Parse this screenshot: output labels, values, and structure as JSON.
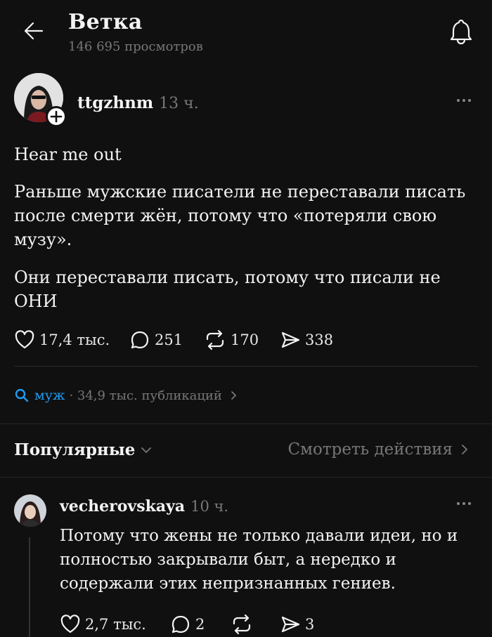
{
  "header": {
    "title": "Ветка",
    "subtitle": "146 695 просмотров"
  },
  "post": {
    "username": "ttgzhnm",
    "time": "13 ч.",
    "paragraphs": [
      "Hear me out",
      "Раньше мужские писатели не переставали писать после смерти жён, потому что «потеряли свою музу».",
      "Они переставали писать, потому что писали не ОНИ"
    ],
    "likes": "17,4 тыс.",
    "comments": "251",
    "reposts": "170",
    "shares": "338"
  },
  "tag": {
    "name": "муж",
    "info": "· 34,9 тыс. публикаций"
  },
  "replies_bar": {
    "sort_label": "Популярные",
    "view_activity_label": "Смотреть действия"
  },
  "reply": {
    "username": "vecherovskaya",
    "time": "10 ч.",
    "text": "Потому что жены не только давали идеи, но и полностью закрывали быт, а нередко и содержали этих непризнанных гениев.",
    "likes": "2,7 тыс.",
    "comments": "2",
    "shares": "3"
  },
  "icons": {
    "back": "arrow-left-icon",
    "bell": "bell-icon",
    "follow": "plus-icon",
    "more": "more-dots-icon",
    "like": "heart-icon",
    "comment": "comment-bubble-icon",
    "repost": "repost-icon",
    "share": "send-icon",
    "search": "search-icon"
  },
  "colors": {
    "background": "#101010",
    "text": "#f3f3f3",
    "muted": "#777777",
    "link": "#1e9bf0"
  }
}
